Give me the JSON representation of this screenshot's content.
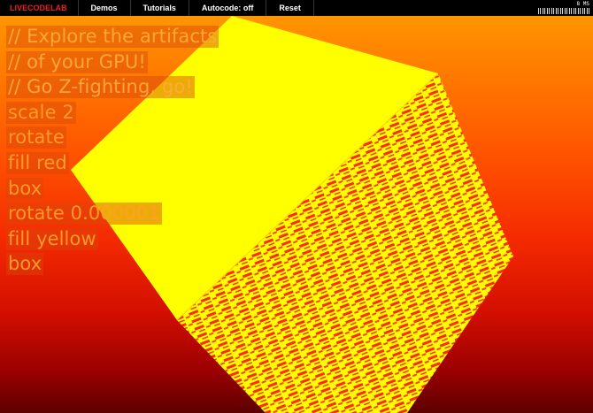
{
  "app": {
    "logo": "LIVECODELAB"
  },
  "menu": {
    "demos": "Demos",
    "tutorials": "Tutorials",
    "autocode": "Autocode: off",
    "reset": "Reset"
  },
  "stats": {
    "fps": "8 MS"
  },
  "editor": {
    "lines": [
      "// Explore the artifacts",
      "// of your GPU!",
      "// Go Z-fighting, go!",
      "scale 2",
      "rotate",
      "fill red",
      "box",
      "rotate 0.000001",
      "fill yellow",
      "box"
    ]
  },
  "colors": {
    "cube_face": "#ffff00",
    "artifact_red": "#ff1a00",
    "menu_bg": "#000000",
    "logo": "#e81f1f"
  }
}
